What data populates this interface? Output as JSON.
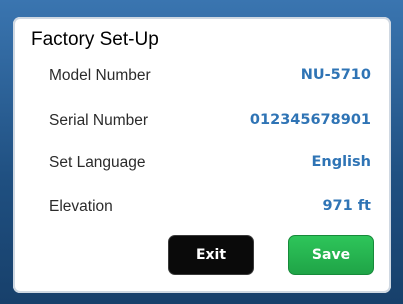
{
  "dialog": {
    "title": "Factory Set-Up"
  },
  "fields": [
    {
      "label": "Model Number",
      "value": "NU-5710"
    },
    {
      "label": "Serial Number",
      "value": "012345678901"
    },
    {
      "label": "Set Language",
      "value": "English"
    },
    {
      "label": "Elevation",
      "value": "971 ft"
    }
  ],
  "buttons": {
    "exit_label": "Exit",
    "save_label": "Save"
  },
  "colors": {
    "value_text": "#2f74b5",
    "save_button": "#22b14c",
    "exit_button": "#0a0a0a",
    "background": "#2a5a8c"
  }
}
